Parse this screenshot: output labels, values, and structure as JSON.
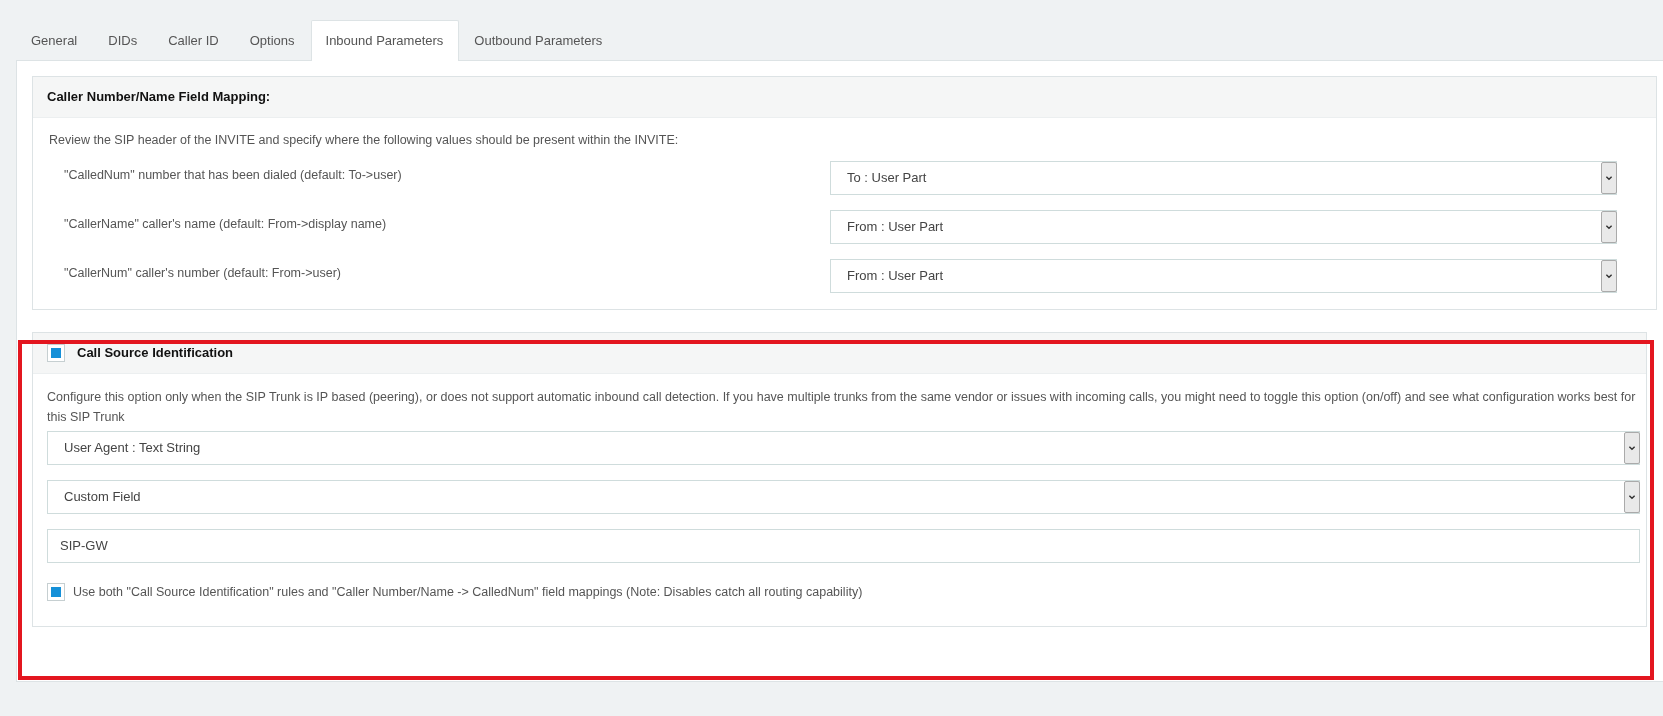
{
  "tabs": [
    {
      "label": "General",
      "selected": false
    },
    {
      "label": "DIDs",
      "selected": false
    },
    {
      "label": "Caller ID",
      "selected": false
    },
    {
      "label": "Options",
      "selected": false
    },
    {
      "label": "Inbound Parameters",
      "selected": true
    },
    {
      "label": "Outbound Parameters",
      "selected": false
    }
  ],
  "field_mapping": {
    "title": "Caller Number/Name Field Mapping:",
    "description": "Review the SIP header of the INVITE and specify where the following values should be present within the INVITE:",
    "rows": [
      {
        "label": "\"CalledNum\" number that has been dialed (default: To->user)",
        "value": "To : User Part"
      },
      {
        "label": "\"CallerName\" caller's name (default: From->display name)",
        "value": "From : User Part"
      },
      {
        "label": "\"CallerNum\" caller's number (default: From->user)",
        "value": "From : User Part"
      }
    ]
  },
  "call_source_identification": {
    "checked": true,
    "title": "Call Source Identification",
    "description": "Configure this option only when the SIP Trunk is IP based (peering), or does not support automatic inbound call detection. If you have multiple trunks from the same vendor or issues with incoming calls, you might need to toggle this option (on/off) and see what configuration works best for this SIP Trunk",
    "match_type": "User Agent : Text String",
    "match_field": "Custom Field",
    "match_value": "SIP-GW",
    "use_both": {
      "checked": true,
      "label": "Use both \"Call Source Identification\" rules and \"Caller Number/Name -> CalledNum\" field mappings (Note: Disables catch all routing capability)"
    }
  }
}
